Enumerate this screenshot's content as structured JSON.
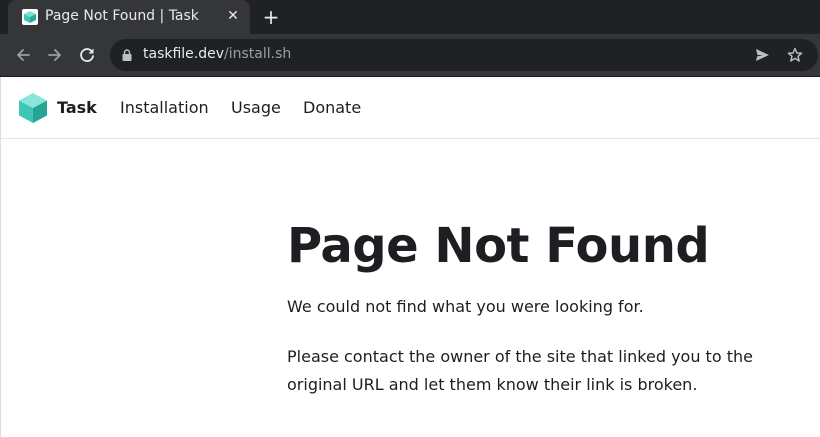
{
  "browser": {
    "tab": {
      "title": "Page Not Found | Task",
      "close_glyph": "✕",
      "favicon": "task-cube-icon"
    },
    "new_tab_glyph": "+",
    "url": {
      "host": "taskfile.dev",
      "path": "/install.sh"
    },
    "icons": [
      "back-arrow-icon",
      "forward-arrow-icon",
      "reload-icon",
      "lock-icon",
      "send-icon",
      "star-icon"
    ],
    "colors": {
      "tabstrip": "#202124",
      "toolbar": "#35363a",
      "omnibox": "#202124"
    }
  },
  "site": {
    "brand": "Task",
    "nav": [
      "Installation",
      "Usage",
      "Donate"
    ],
    "colors": {
      "logo_teal": "#3fc6b7",
      "text": "#1c1e21"
    }
  },
  "page": {
    "heading": "Page Not Found",
    "paragraphs": [
      "We could not find what you were looking for.",
      "Please contact the owner of the site that linked you to the original URL and let them know their link is broken."
    ]
  }
}
